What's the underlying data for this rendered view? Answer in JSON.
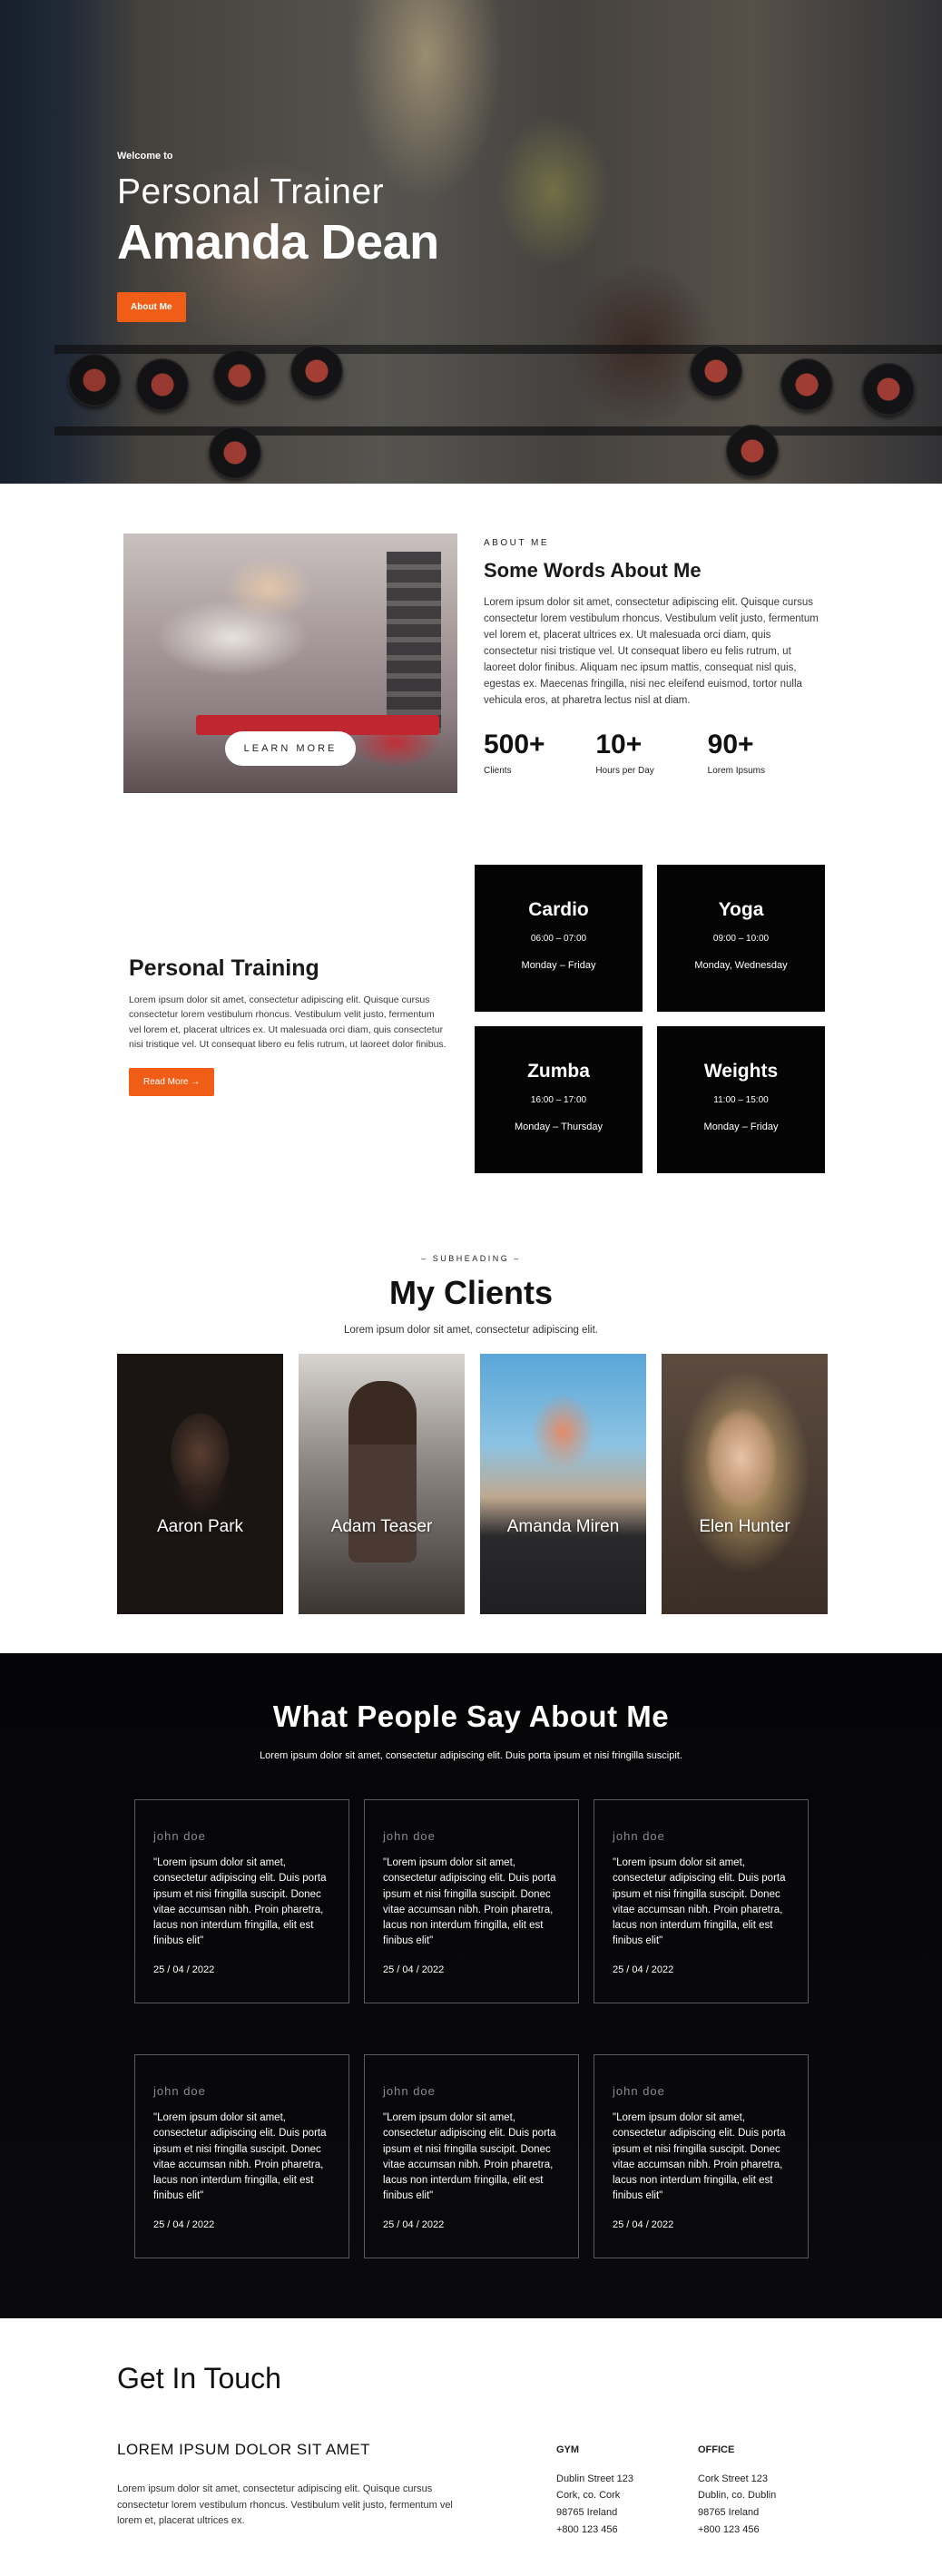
{
  "hero": {
    "welcome": "Welcome to",
    "role": "Personal Trainer",
    "name": "Amanda Dean",
    "button": "About Me"
  },
  "about": {
    "learn_more": "LEARN MORE",
    "eyebrow": "ABOUT ME",
    "title": "Some Words About Me",
    "body": "Lorem ipsum dolor sit amet, consectetur adipiscing elit. Quisque cursus consectetur lorem vestibulum rhoncus. Vestibulum velit justo, fermentum vel lorem et, placerat ultrices ex. Ut malesuada orci diam, quis consectetur nisi tristique vel. Ut consequat libero eu felis rutrum, ut laoreet dolor finibus. Aliquam nec ipsum mattis, consequat nisl quis, egestas ex. Maecenas fringilla, nisi nec eleifend euismod, tortor nulla vehicula eros, at pharetra lectus nisl at diam.",
    "stats": [
      {
        "value": "500+",
        "label": "Clients"
      },
      {
        "value": "10+",
        "label": "Hours per Day"
      },
      {
        "value": "90+",
        "label": "Lorem Ipsums"
      }
    ]
  },
  "training": {
    "title": "Personal Training",
    "body": "Lorem ipsum dolor sit amet, consectetur adipiscing elit. Quisque cursus consectetur lorem vestibulum rhoncus. Vestibulum velit justo, fermentum vel lorem et, placerat ultrices ex. Ut malesuada orci diam, quis consectetur nisi tristique vel. Ut consequat libero eu felis rutrum, ut laoreet dolor finibus.",
    "button": "Read More →",
    "classes": [
      {
        "title": "Cardio",
        "time": "06:00 – 07:00",
        "days": "Monday – Friday"
      },
      {
        "title": "Yoga",
        "time": "09:00 – 10:00",
        "days": "Monday, Wednesday"
      },
      {
        "title": "Zumba",
        "time": "16:00 – 17:00",
        "days": "Monday – Thursday"
      },
      {
        "title": "Weights",
        "time": "11:00 – 15:00",
        "days": "Monday – Friday"
      }
    ]
  },
  "clients": {
    "subheading": "– SUBHEADING –",
    "title": "My Clients",
    "desc": "Lorem ipsum dolor sit amet, consectetur adipiscing elit.",
    "people": [
      "Aaron Park",
      "Adam Teaser",
      "Amanda Miren",
      "Elen Hunter"
    ]
  },
  "testimonials": {
    "title": "What People Say About Me",
    "desc": "Lorem ipsum dolor sit amet, consectetur adipiscing elit. Duis porta ipsum et nisi fringilla suscipit.",
    "items": [
      {
        "name": "john doe",
        "quote": "\"Lorem ipsum dolor sit amet, consectetur adipiscing elit. Duis porta ipsum et nisi fringilla suscipit. Donec vitae accumsan nibh. Proin pharetra, lacus non interdum fringilla, elit est finibus elit\"",
        "date": "25 / 04 / 2022"
      },
      {
        "name": "john doe",
        "quote": "\"Lorem ipsum dolor sit amet, consectetur adipiscing elit. Duis porta ipsum et nisi fringilla suscipit. Donec vitae accumsan nibh. Proin pharetra, lacus non interdum fringilla, elit est finibus elit\"",
        "date": "25 / 04 / 2022"
      },
      {
        "name": "john doe",
        "quote": "\"Lorem ipsum dolor sit amet, consectetur adipiscing elit. Duis porta ipsum et nisi fringilla suscipit. Donec vitae accumsan nibh. Proin pharetra, lacus non interdum fringilla, elit est finibus elit\"",
        "date": "25 / 04 / 2022"
      },
      {
        "name": "john doe",
        "quote": "\"Lorem ipsum dolor sit amet, consectetur adipiscing elit. Duis porta ipsum et nisi fringilla suscipit. Donec vitae accumsan nibh. Proin pharetra, lacus non interdum fringilla, elit est finibus elit\"",
        "date": "25 / 04 / 2022"
      },
      {
        "name": "john doe",
        "quote": "\"Lorem ipsum dolor sit amet, consectetur adipiscing elit. Duis porta ipsum et nisi fringilla suscipit. Donec vitae accumsan nibh. Proin pharetra, lacus non interdum fringilla, elit est finibus elit\"",
        "date": "25 / 04 / 2022"
      },
      {
        "name": "john doe",
        "quote": "\"Lorem ipsum dolor sit amet, consectetur adipiscing elit. Duis porta ipsum et nisi fringilla suscipit. Donec vitae accumsan nibh. Proin pharetra, lacus non interdum fringilla, elit est finibus elit\"",
        "date": "25 / 04 / 2022"
      }
    ]
  },
  "contact": {
    "title": "Get In Touch",
    "heading": "LOREM IPSUM DOLOR SIT AMET",
    "body": "Lorem ipsum dolor sit amet, consectetur adipiscing elit. Quisque cursus consectetur lorem vestibulum rhoncus. Vestibulum velit justo, fermentum vel lorem et, placerat ultrices ex.",
    "gym": {
      "heading": "GYM",
      "lines": [
        "Dublin Street 123",
        "Cork, co. Cork",
        "98765 Ireland",
        "+800 123 456"
      ]
    },
    "office": {
      "heading": "OFFICE",
      "lines": [
        "Cork Street 123",
        "Dublin, co. Dublin",
        "98765 Ireland",
        "+800 123 456"
      ]
    }
  },
  "colors": {
    "accent": "#f05d16",
    "dark": "#050405"
  }
}
